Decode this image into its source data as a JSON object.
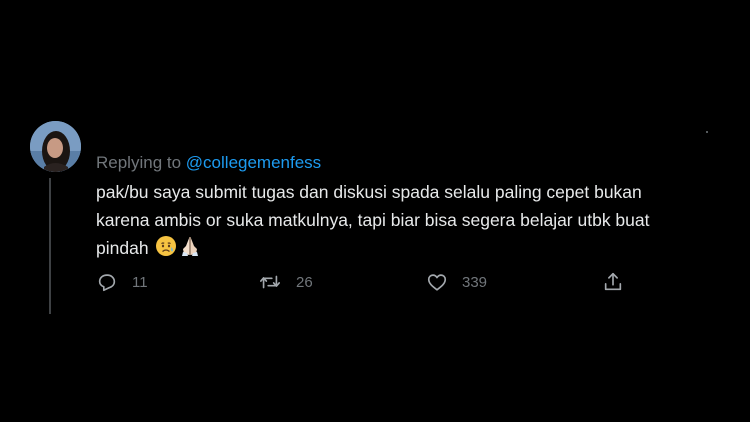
{
  "tweet": {
    "replying_prefix": "Replying to",
    "replying_handle": "@collegemenfess",
    "text_lines": [
      "pak/bu saya submit tugas dan diskusi spada selalu paling cepet bukan",
      "karena ambis or suka matkulnya, tapi biar bisa segera belajar utbk buat",
      "pindah"
    ],
    "emojis": [
      "sad-but-relieved-face-emoji",
      "folded-hands-emoji"
    ],
    "counts": {
      "replies": "11",
      "retweets": "26",
      "likes": "339"
    }
  },
  "icons": {
    "reply": "reply-icon",
    "retweet": "retweet-icon",
    "like": "heart-icon",
    "share": "share-icon"
  },
  "colors": {
    "background": "#000000",
    "text": "#e7e9ea",
    "muted": "#71767b",
    "link": "#1d9bf0"
  }
}
